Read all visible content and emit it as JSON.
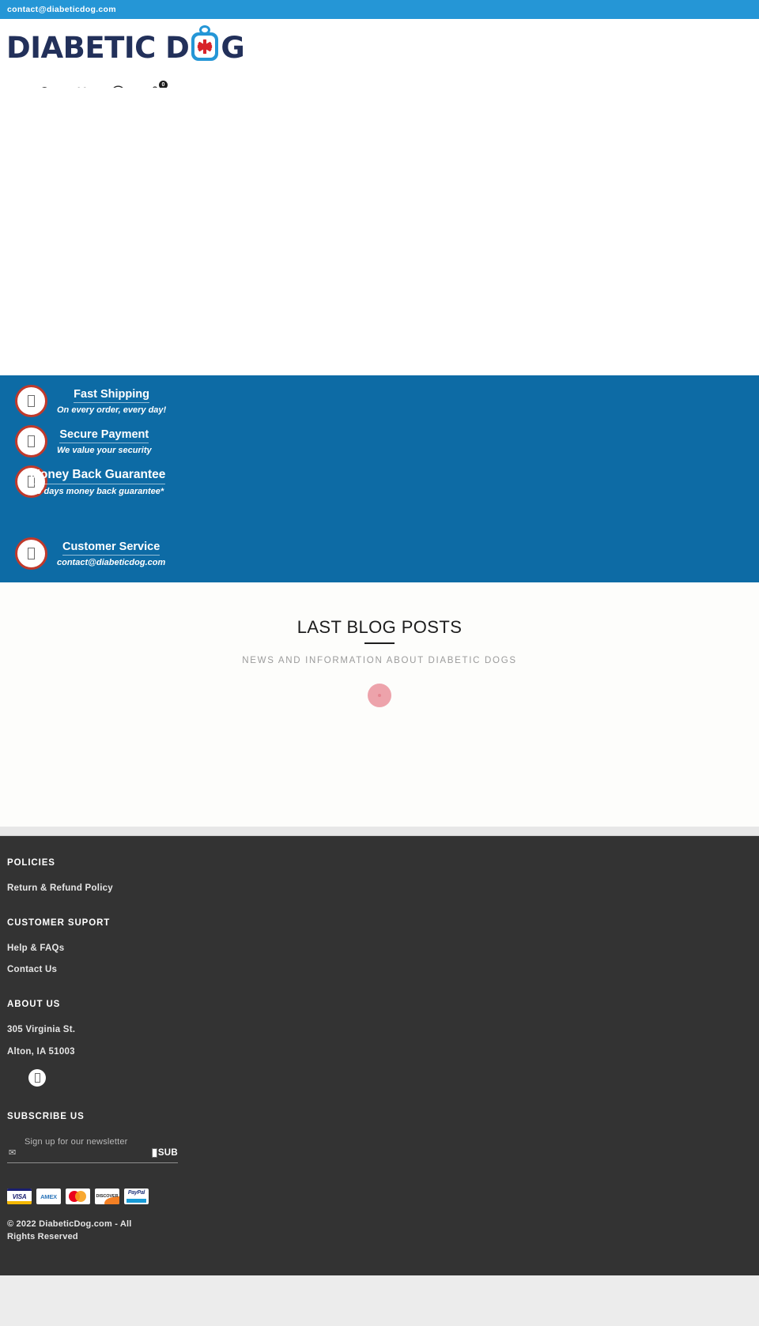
{
  "topbar": {
    "email": "contact@diabeticdog.com"
  },
  "header": {
    "logo_part1": "DIABETIC D",
    "logo_part2": "G",
    "logo_alt": "DIABETIC DOG",
    "icons": {
      "search": "search-icon",
      "wishlist": "heart-icon",
      "account": "user-icon",
      "cart": "shopping-bag-icon",
      "menu": "hamburger-menu-icon"
    },
    "cart_count": "0"
  },
  "hero": {
    "broken_image_glyph": "☒"
  },
  "features": [
    {
      "icon": "",
      "title": "Fast Shipping",
      "subtitle": "On every order, every day!"
    },
    {
      "icon": "",
      "title": "Secure Payment",
      "subtitle": "We value your security"
    },
    {
      "icon": "",
      "title": "Money Back Guarantee",
      "subtitle": "30 days money back guarantee*"
    },
    {
      "icon": "",
      "title": "Customer Service",
      "subtitle": "contact@diabeticdog.com"
    }
  ],
  "blog": {
    "title": "LAST BLOG POSTS",
    "subtitle": "NEWS AND INFORMATION ABOUT DIABETIC DOGS",
    "loading": true
  },
  "footer": {
    "policies": {
      "heading": "POLICIES",
      "links": [
        "Return & Refund Policy"
      ]
    },
    "support": {
      "heading": "CUSTOMER SUPORT",
      "links": [
        "Help & FAQs",
        "Contact Us"
      ]
    },
    "about": {
      "heading": "ABOUT US",
      "address_line1": "305 Virginia St.",
      "address_line2": "Alton, IA 51003",
      "social": "facebook-icon"
    },
    "subscribe": {
      "heading": "SUBSCRIBE US",
      "placeholder": "Sign up for our newsletter",
      "value": "",
      "left_glyph": "✉",
      "button_label": "SUB"
    },
    "payments": [
      "VISA",
      "AMEX",
      "Mastercard",
      "DISCOVER",
      "PayPal"
    ],
    "copyright": "© 2022 DiabeticDog.com - All Rights Reserved"
  },
  "colors": {
    "topbar_blue": "#2596d6",
    "features_blue": "#0d6ba5",
    "icon_ring_red": "#c0392b",
    "footer_dark": "#333333",
    "logo_navy": "#22305a",
    "loader_pink": "#eda3ab"
  }
}
